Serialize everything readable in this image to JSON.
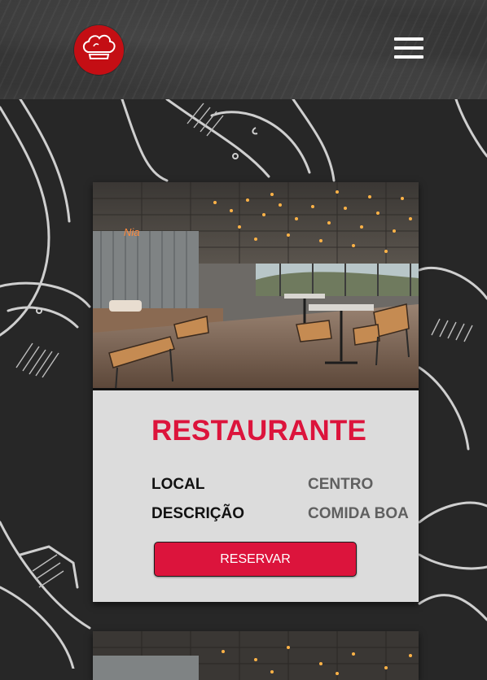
{
  "header": {
    "logo_icon": "chef-hat-icon",
    "menu_icon": "hamburger-menu-icon"
  },
  "colors": {
    "accent": "#dc143c",
    "logo_red": "#c40e14",
    "background": "#272727",
    "card": "#dcdcdc"
  },
  "cards": [
    {
      "image_icon": "restaurant-interior-photo",
      "title": "RESTAURANTE",
      "details": [
        {
          "label": "LOCAL",
          "value": "CENTRO"
        },
        {
          "label": "DESCRIÇÃO",
          "value": "COMIDA BOA"
        }
      ],
      "button_label": "RESERVAR"
    },
    {
      "image_icon": "restaurant-interior-photo"
    }
  ]
}
